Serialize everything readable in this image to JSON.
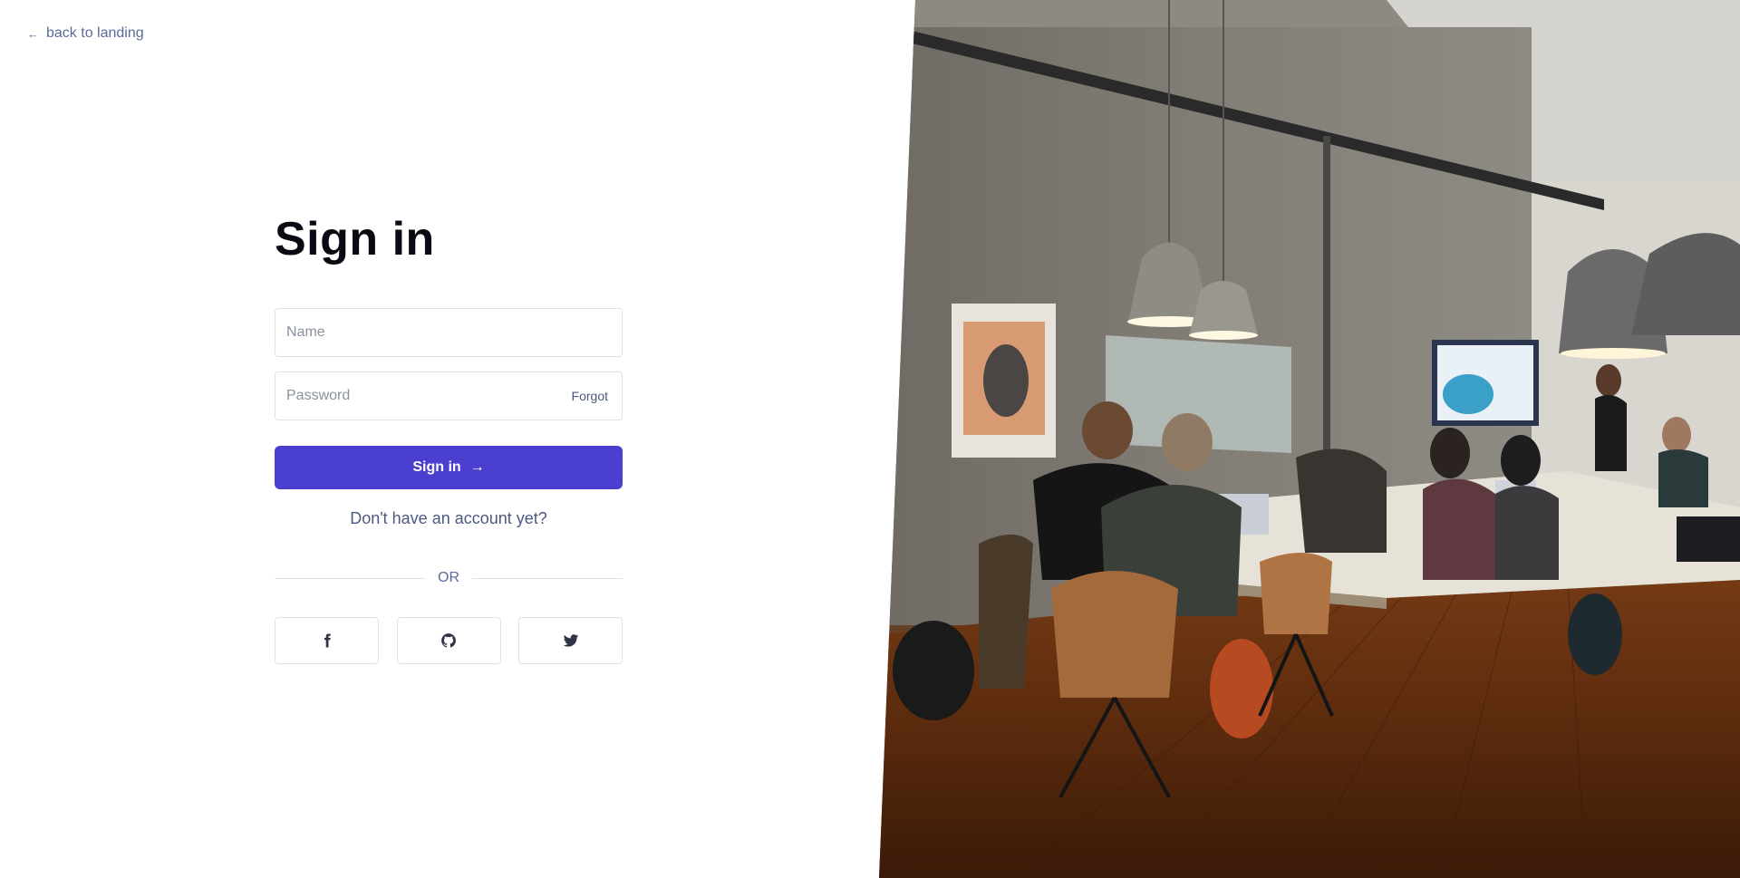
{
  "nav": {
    "back_label": "back to landing",
    "back_icon": "arrow-left-icon"
  },
  "form": {
    "title": "Sign in",
    "name_placeholder": "Name",
    "name_value": "",
    "password_placeholder": "Password",
    "password_value": "",
    "forgot_label": "Forgot",
    "submit_label": "Sign in",
    "submit_icon": "arrow-right-icon",
    "signup_prompt": "Don't have an account yet?",
    "divider_label": "OR"
  },
  "social": [
    {
      "icon": "facebook-icon"
    },
    {
      "icon": "github-icon"
    },
    {
      "icon": "twitter-icon"
    }
  ],
  "colors": {
    "accent": "#4b3fd0",
    "muted_text": "#5b6b9a",
    "border": "#dde1e8"
  }
}
